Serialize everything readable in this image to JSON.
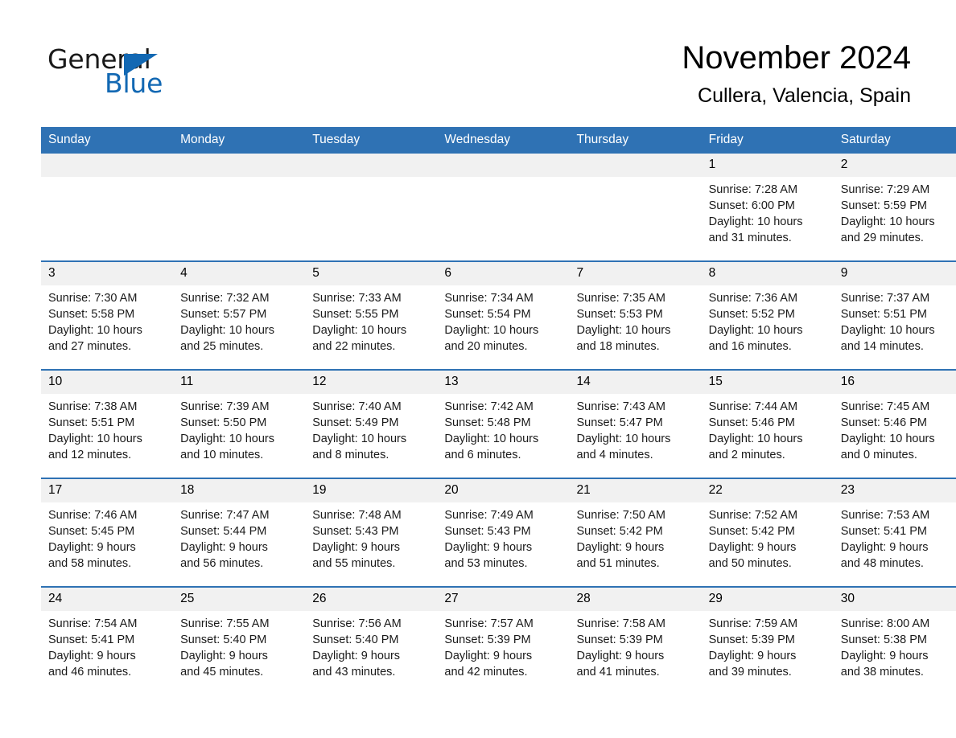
{
  "brand": {
    "name_part1": "General",
    "name_part2": "Blue",
    "accent_color": "#1268b3"
  },
  "header": {
    "title": "November 2024",
    "location": "Cullera, Valencia, Spain"
  },
  "calendar": {
    "header_bg": "#2f72b4",
    "daynum_bg": "#f1f1f1",
    "weekdays": [
      "Sunday",
      "Monday",
      "Tuesday",
      "Wednesday",
      "Thursday",
      "Friday",
      "Saturday"
    ],
    "weeks": [
      [
        {
          "day": "",
          "blank": true
        },
        {
          "day": "",
          "blank": true
        },
        {
          "day": "",
          "blank": true
        },
        {
          "day": "",
          "blank": true
        },
        {
          "day": "",
          "blank": true
        },
        {
          "day": "1",
          "sunrise": "Sunrise: 7:28 AM",
          "sunset": "Sunset: 6:00 PM",
          "daylight1": "Daylight: 10 hours",
          "daylight2": "and 31 minutes."
        },
        {
          "day": "2",
          "sunrise": "Sunrise: 7:29 AM",
          "sunset": "Sunset: 5:59 PM",
          "daylight1": "Daylight: 10 hours",
          "daylight2": "and 29 minutes."
        }
      ],
      [
        {
          "day": "3",
          "sunrise": "Sunrise: 7:30 AM",
          "sunset": "Sunset: 5:58 PM",
          "daylight1": "Daylight: 10 hours",
          "daylight2": "and 27 minutes."
        },
        {
          "day": "4",
          "sunrise": "Sunrise: 7:32 AM",
          "sunset": "Sunset: 5:57 PM",
          "daylight1": "Daylight: 10 hours",
          "daylight2": "and 25 minutes."
        },
        {
          "day": "5",
          "sunrise": "Sunrise: 7:33 AM",
          "sunset": "Sunset: 5:55 PM",
          "daylight1": "Daylight: 10 hours",
          "daylight2": "and 22 minutes."
        },
        {
          "day": "6",
          "sunrise": "Sunrise: 7:34 AM",
          "sunset": "Sunset: 5:54 PM",
          "daylight1": "Daylight: 10 hours",
          "daylight2": "and 20 minutes."
        },
        {
          "day": "7",
          "sunrise": "Sunrise: 7:35 AM",
          "sunset": "Sunset: 5:53 PM",
          "daylight1": "Daylight: 10 hours",
          "daylight2": "and 18 minutes."
        },
        {
          "day": "8",
          "sunrise": "Sunrise: 7:36 AM",
          "sunset": "Sunset: 5:52 PM",
          "daylight1": "Daylight: 10 hours",
          "daylight2": "and 16 minutes."
        },
        {
          "day": "9",
          "sunrise": "Sunrise: 7:37 AM",
          "sunset": "Sunset: 5:51 PM",
          "daylight1": "Daylight: 10 hours",
          "daylight2": "and 14 minutes."
        }
      ],
      [
        {
          "day": "10",
          "sunrise": "Sunrise: 7:38 AM",
          "sunset": "Sunset: 5:51 PM",
          "daylight1": "Daylight: 10 hours",
          "daylight2": "and 12 minutes."
        },
        {
          "day": "11",
          "sunrise": "Sunrise: 7:39 AM",
          "sunset": "Sunset: 5:50 PM",
          "daylight1": "Daylight: 10 hours",
          "daylight2": "and 10 minutes."
        },
        {
          "day": "12",
          "sunrise": "Sunrise: 7:40 AM",
          "sunset": "Sunset: 5:49 PM",
          "daylight1": "Daylight: 10 hours",
          "daylight2": "and 8 minutes."
        },
        {
          "day": "13",
          "sunrise": "Sunrise: 7:42 AM",
          "sunset": "Sunset: 5:48 PM",
          "daylight1": "Daylight: 10 hours",
          "daylight2": "and 6 minutes."
        },
        {
          "day": "14",
          "sunrise": "Sunrise: 7:43 AM",
          "sunset": "Sunset: 5:47 PM",
          "daylight1": "Daylight: 10 hours",
          "daylight2": "and 4 minutes."
        },
        {
          "day": "15",
          "sunrise": "Sunrise: 7:44 AM",
          "sunset": "Sunset: 5:46 PM",
          "daylight1": "Daylight: 10 hours",
          "daylight2": "and 2 minutes."
        },
        {
          "day": "16",
          "sunrise": "Sunrise: 7:45 AM",
          "sunset": "Sunset: 5:46 PM",
          "daylight1": "Daylight: 10 hours",
          "daylight2": "and 0 minutes."
        }
      ],
      [
        {
          "day": "17",
          "sunrise": "Sunrise: 7:46 AM",
          "sunset": "Sunset: 5:45 PM",
          "daylight1": "Daylight: 9 hours",
          "daylight2": "and 58 minutes."
        },
        {
          "day": "18",
          "sunrise": "Sunrise: 7:47 AM",
          "sunset": "Sunset: 5:44 PM",
          "daylight1": "Daylight: 9 hours",
          "daylight2": "and 56 minutes."
        },
        {
          "day": "19",
          "sunrise": "Sunrise: 7:48 AM",
          "sunset": "Sunset: 5:43 PM",
          "daylight1": "Daylight: 9 hours",
          "daylight2": "and 55 minutes."
        },
        {
          "day": "20",
          "sunrise": "Sunrise: 7:49 AM",
          "sunset": "Sunset: 5:43 PM",
          "daylight1": "Daylight: 9 hours",
          "daylight2": "and 53 minutes."
        },
        {
          "day": "21",
          "sunrise": "Sunrise: 7:50 AM",
          "sunset": "Sunset: 5:42 PM",
          "daylight1": "Daylight: 9 hours",
          "daylight2": "and 51 minutes."
        },
        {
          "day": "22",
          "sunrise": "Sunrise: 7:52 AM",
          "sunset": "Sunset: 5:42 PM",
          "daylight1": "Daylight: 9 hours",
          "daylight2": "and 50 minutes."
        },
        {
          "day": "23",
          "sunrise": "Sunrise: 7:53 AM",
          "sunset": "Sunset: 5:41 PM",
          "daylight1": "Daylight: 9 hours",
          "daylight2": "and 48 minutes."
        }
      ],
      [
        {
          "day": "24",
          "sunrise": "Sunrise: 7:54 AM",
          "sunset": "Sunset: 5:41 PM",
          "daylight1": "Daylight: 9 hours",
          "daylight2": "and 46 minutes."
        },
        {
          "day": "25",
          "sunrise": "Sunrise: 7:55 AM",
          "sunset": "Sunset: 5:40 PM",
          "daylight1": "Daylight: 9 hours",
          "daylight2": "and 45 minutes."
        },
        {
          "day": "26",
          "sunrise": "Sunrise: 7:56 AM",
          "sunset": "Sunset: 5:40 PM",
          "daylight1": "Daylight: 9 hours",
          "daylight2": "and 43 minutes."
        },
        {
          "day": "27",
          "sunrise": "Sunrise: 7:57 AM",
          "sunset": "Sunset: 5:39 PM",
          "daylight1": "Daylight: 9 hours",
          "daylight2": "and 42 minutes."
        },
        {
          "day": "28",
          "sunrise": "Sunrise: 7:58 AM",
          "sunset": "Sunset: 5:39 PM",
          "daylight1": "Daylight: 9 hours",
          "daylight2": "and 41 minutes."
        },
        {
          "day": "29",
          "sunrise": "Sunrise: 7:59 AM",
          "sunset": "Sunset: 5:39 PM",
          "daylight1": "Daylight: 9 hours",
          "daylight2": "and 39 minutes."
        },
        {
          "day": "30",
          "sunrise": "Sunrise: 8:00 AM",
          "sunset": "Sunset: 5:38 PM",
          "daylight1": "Daylight: 9 hours",
          "daylight2": "and 38 minutes."
        }
      ]
    ]
  }
}
